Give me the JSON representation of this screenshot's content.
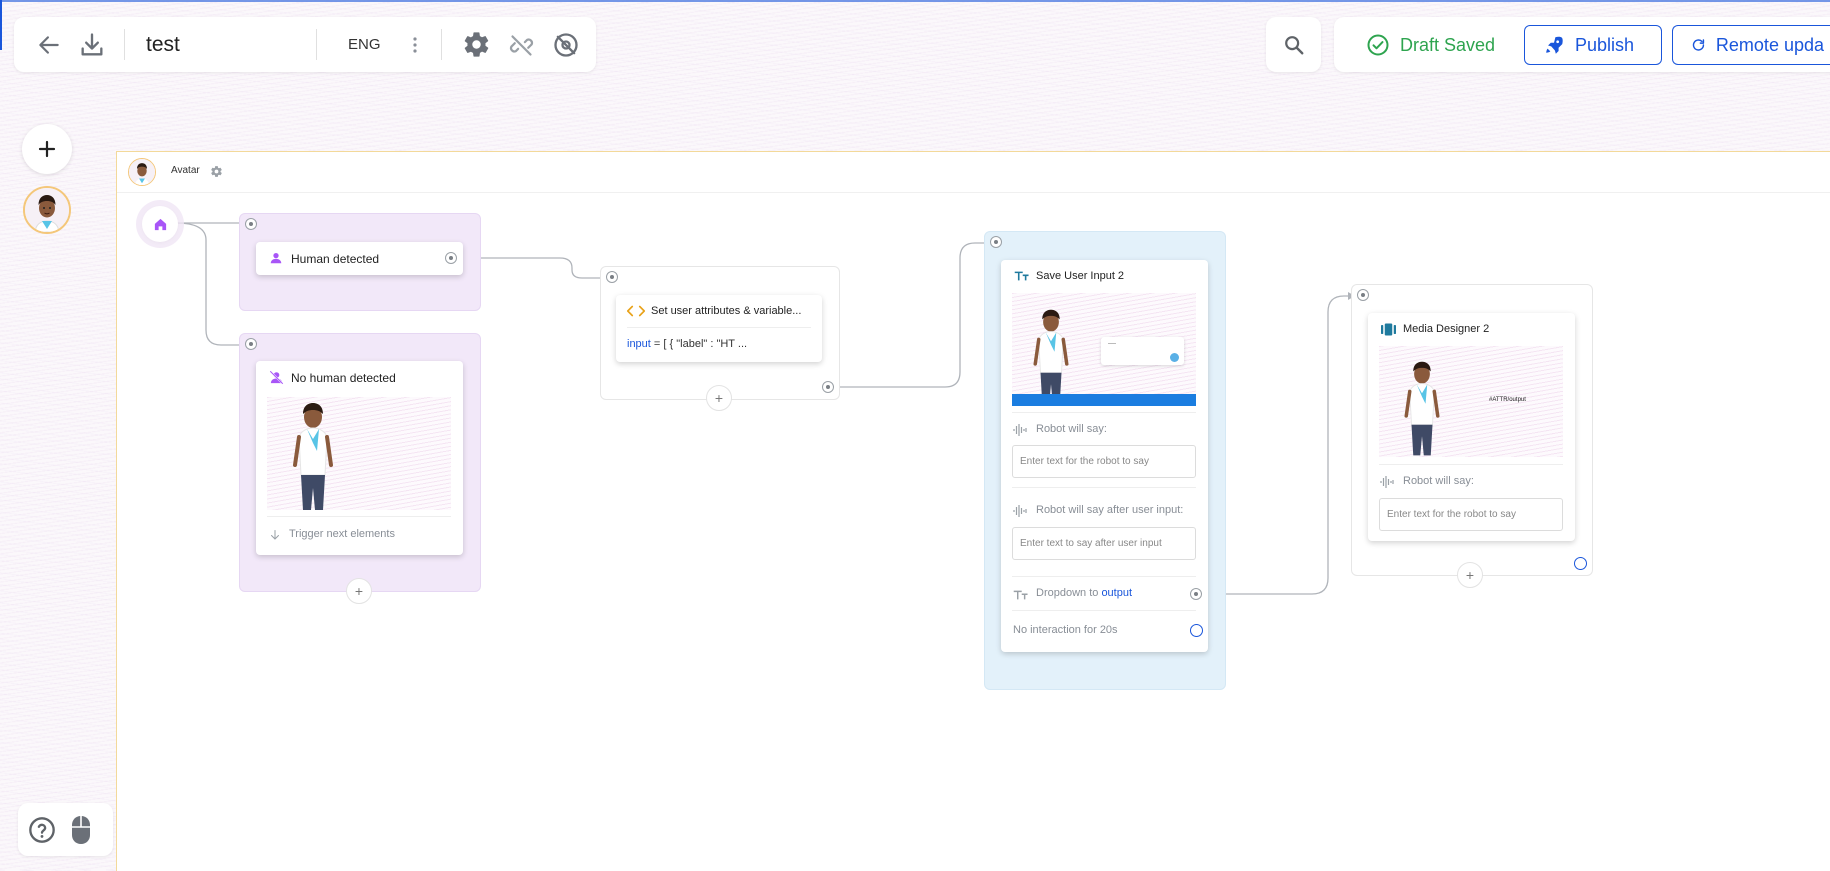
{
  "toolbar": {
    "title": "test",
    "language": "ENG",
    "draft_status": "Draft Saved",
    "publish_label": "Publish",
    "remote_label": "Remote upda"
  },
  "canvas": {
    "header_label": "Avatar"
  },
  "nodes": {
    "human_detected": {
      "title": "Human detected"
    },
    "no_human_detected": {
      "title": "No human detected",
      "trigger_label": "Trigger next elements"
    },
    "set_attributes": {
      "title": "Set user attributes & variable...",
      "code_key": "input",
      "code_rest": " = [ { \"label\" : \"HT ..."
    },
    "save_user_input": {
      "title": "Save User Input 2",
      "robot_say_label": "Robot will say:",
      "robot_say_placeholder": "Enter text for the robot to say",
      "robot_after_label": "Robot will say after user input:",
      "robot_after_placeholder": "Enter text to say after user input",
      "dropdown_prefix": "Dropdown to ",
      "dropdown_target": "output",
      "no_interaction": "No interaction for 20s"
    },
    "media_designer": {
      "title": "Media Designer 2",
      "preview_text": "#ATTR/output",
      "robot_say_label": "Robot will say:",
      "robot_say_placeholder": "Enter text for the robot to say"
    }
  },
  "colors": {
    "accent_blue": "#1a56db",
    "success_green": "#2ea44f",
    "purple": "#a855f7",
    "code_orange": "#e8a21a",
    "teal_icon": "#1f7a9e"
  },
  "icons": {
    "back": "arrow-left-icon",
    "download": "download-icon",
    "more": "vertical-dots-icon",
    "settings": "gear-icon",
    "unlink": "link-off-icon",
    "hide": "eye-off-icon",
    "search": "search-icon",
    "check": "check-circle-icon",
    "rocket": "rocket-icon",
    "refresh": "refresh-icon",
    "help": "help-circle-icon",
    "mouse": "mouse-icon"
  }
}
